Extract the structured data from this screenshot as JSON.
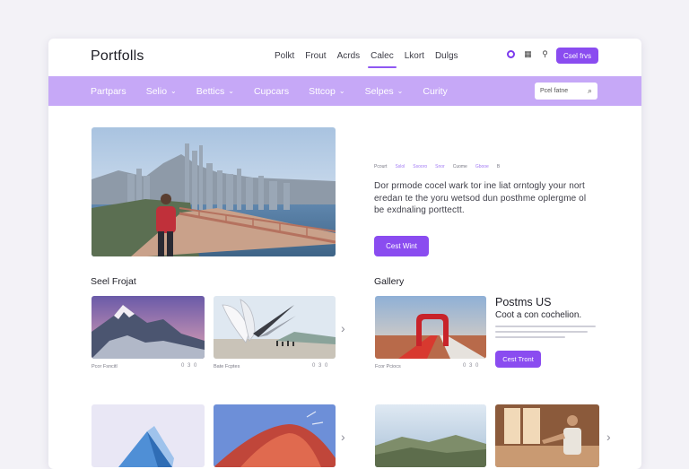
{
  "brand": "Portfolls",
  "top_nav": [
    {
      "label": "Polkt",
      "active": false
    },
    {
      "label": "Frout",
      "active": false
    },
    {
      "label": "Acrds",
      "active": false
    },
    {
      "label": "Calec",
      "active": true
    },
    {
      "label": "Lkort",
      "active": false
    },
    {
      "label": "Dulgs",
      "active": false
    }
  ],
  "top_icons": [
    "record-icon",
    "grid-icon",
    "pin-icon"
  ],
  "top_button": "Csel frvs",
  "purple_nav": [
    {
      "label": "Partpars",
      "dropdown": false
    },
    {
      "label": "Selio",
      "dropdown": true
    },
    {
      "label": "Bettics",
      "dropdown": true
    },
    {
      "label": "Cupcars",
      "dropdown": false
    },
    {
      "label": "Sttcop",
      "dropdown": true
    },
    {
      "label": "Selpes",
      "dropdown": true
    },
    {
      "label": "Curity",
      "dropdown": false
    }
  ],
  "search": {
    "placeholder": "Pcel fatne"
  },
  "hero": {
    "crumbs": [
      "Pcourt",
      "Sslol",
      "Ssooro",
      "Snor",
      "Cuome",
      "Gbooe",
      "B"
    ],
    "paragraph": "Dor prmode cocel wark tor ine liat orntogly your nort eredan te the yoru wetsod dun posthme oplergme ol be exdnaling porttectt.",
    "button": "Cest Wint"
  },
  "left_section": {
    "title": "Seel Frojat",
    "items": [
      {
        "caption": "Pcor Fsncitl",
        "meta": "0 3 0"
      },
      {
        "caption": "Bate Fcptes",
        "meta": "0 3 0"
      }
    ]
  },
  "gallery": {
    "title": "Gallery",
    "item": {
      "caption": "Fcor Pciocs",
      "meta": "0 3 0"
    },
    "side_title": "Postms US",
    "side_subtitle": "Coot a con cochelion.",
    "side_button": "Cest Tront"
  },
  "colors": {
    "accent": "#8a4cf0",
    "nav_band": "#c6a8f7",
    "background": "#f3f2f7"
  }
}
